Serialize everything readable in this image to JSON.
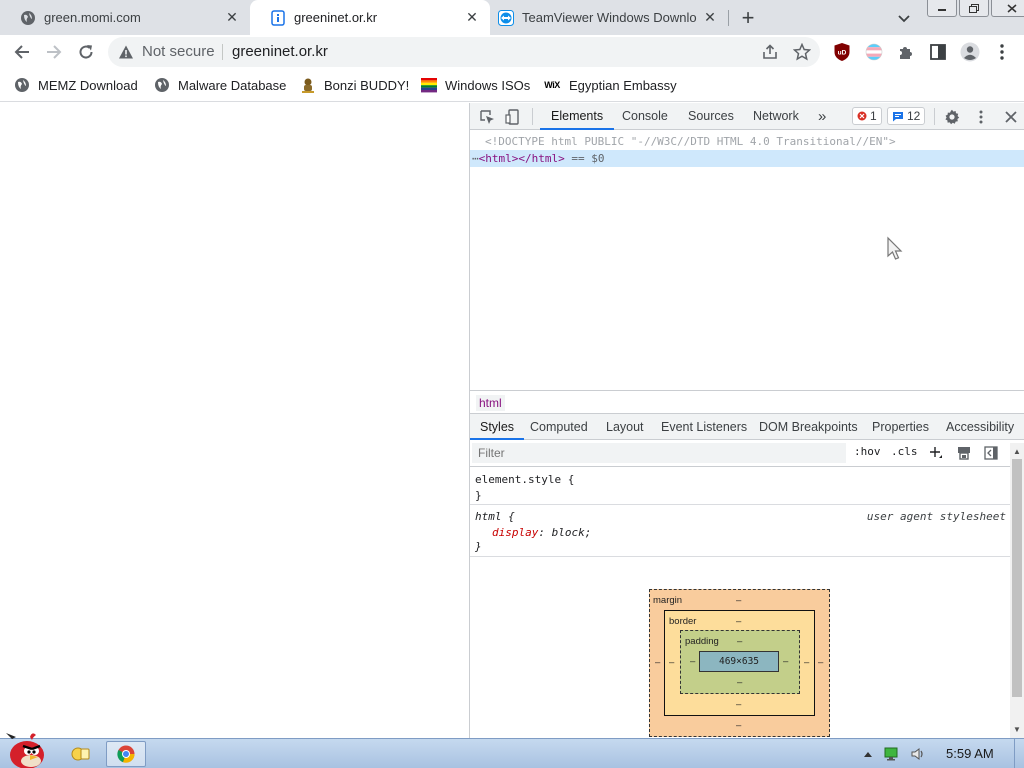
{
  "browser": {
    "tabs": [
      {
        "title": "green.momi.com",
        "icon": "globe-icon",
        "active": false
      },
      {
        "title": "greeninet.or.kr",
        "icon": "page-icon",
        "active": true
      },
      {
        "title": "TeamViewer Windows Downlo",
        "icon": "teamviewer-icon",
        "active": false
      }
    ],
    "new_tab_label": "+",
    "address": {
      "security_label": "Not secure",
      "url": "greeninet.or.kr"
    },
    "bookmarks": [
      {
        "label": "MEMZ Download",
        "icon": "globe-icon"
      },
      {
        "label": "Malware Database",
        "icon": "globe-icon"
      },
      {
        "label": "Bonzi BUDDY!",
        "icon": "bonzi-icon"
      },
      {
        "label": "Windows ISOs",
        "icon": "rainbow-flag-icon"
      },
      {
        "label": "Egyptian Embassy",
        "icon": "wix-icon",
        "icon_text": "WiX"
      }
    ],
    "extension_label": "uD"
  },
  "devtools": {
    "tabs": [
      "Elements",
      "Console",
      "Sources",
      "Network"
    ],
    "more_tabs": "»",
    "error_count": "1",
    "message_count": "12",
    "dom": {
      "doctype": "<!DOCTYPE html PUBLIC \"-//W3C//DTD HTML 4.0 Transitional//EN\">",
      "ellipsis": "⋯",
      "selected_open": "<html>",
      "selected_close": "</html>",
      "selected_suffix": " == $0"
    },
    "breadcrumb": "html",
    "subtabs": [
      "Styles",
      "Computed",
      "Layout",
      "Event Listeners",
      "DOM Breakpoints",
      "Properties",
      "Accessibility"
    ],
    "filter_placeholder": "Filter",
    "hov": ":hov",
    "cls": ".cls",
    "rules": {
      "element_style_open": "element.style {",
      "close_brace": "}",
      "html_selector": "html {",
      "html_source": "user agent stylesheet",
      "html_prop": "display",
      "html_value": "block;"
    },
    "box_model": {
      "margin_label": "margin",
      "border_label": "border",
      "padding_label": "padding",
      "content_size": "469×635",
      "dash": "–"
    }
  },
  "taskbar": {
    "clock": "5:59 AM"
  },
  "colors": {
    "accent": "#1a73e8",
    "tag": "#881280",
    "selected_row": "#cfe8fc"
  }
}
